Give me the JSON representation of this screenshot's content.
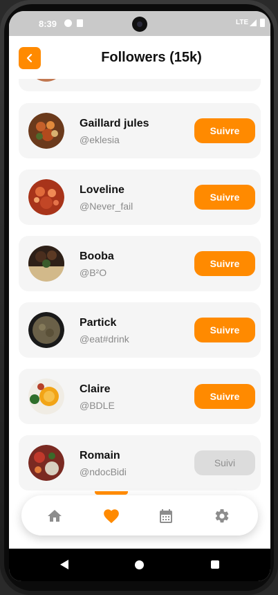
{
  "status_bar": {
    "time": "8:39",
    "network": "LTE"
  },
  "header": {
    "title": "Followers (15k)",
    "back_icon": "chevron-left-icon"
  },
  "colors": {
    "accent": "#ff8a00",
    "card_bg": "#f5f5f5",
    "following_bg": "#dcdcdc"
  },
  "followers": [
    {
      "name": "Gaillard jules",
      "handle": "@eklesia",
      "button": "Suivre",
      "state": "follow"
    },
    {
      "name": "Loveline",
      "handle": "@Never_fail",
      "button": "Suivre",
      "state": "follow"
    },
    {
      "name": "Booba",
      "handle": "@B²O",
      "button": "Suivre",
      "state": "follow"
    },
    {
      "name": "Partick",
      "handle": "@eat#drink",
      "button": "Suivre",
      "state": "follow"
    },
    {
      "name": "Claire",
      "handle": "@BDLE",
      "button": "Suivre",
      "state": "follow"
    },
    {
      "name": "Romain",
      "handle": "@ndocBidi",
      "button": "Suivi",
      "state": "following"
    }
  ],
  "bottom_nav": [
    {
      "icon": "home-icon",
      "active": false
    },
    {
      "icon": "heart-icon",
      "active": true
    },
    {
      "icon": "calendar-icon",
      "active": false
    },
    {
      "icon": "gear-icon",
      "active": false
    }
  ]
}
